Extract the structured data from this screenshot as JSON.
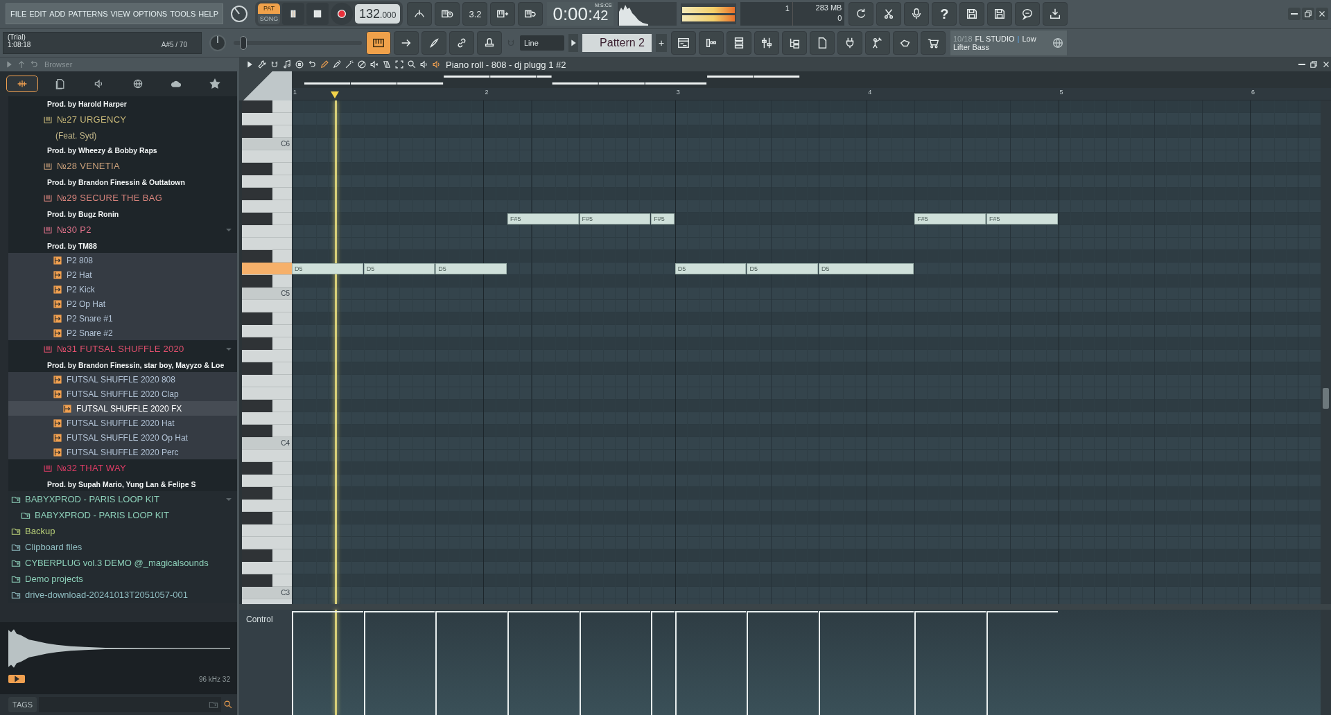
{
  "menu": [
    "FILE",
    "EDIT",
    "ADD",
    "PATTERNS",
    "VIEW",
    "OPTIONS",
    "TOOLS",
    "HELP"
  ],
  "mode": [
    {
      "label": "PAT",
      "selected": true
    },
    {
      "label": "SONG",
      "selected": false
    }
  ],
  "tempo": {
    "whole": "132",
    "fraction": ".000"
  },
  "countdown_label": "3.2",
  "time": {
    "main": "0:00:",
    "cs": "42",
    "unit": "M:S:CS"
  },
  "cpu": {
    "value": "1",
    "memory": "283 MB",
    "polyphony": "0"
  },
  "help_label": "?",
  "hint": {
    "title": "(Trial)",
    "time": "1:08:18",
    "note": "A#5 / 70"
  },
  "view_buttons": [
    {
      "selected": true
    },
    {
      "selected": false
    },
    {
      "selected": false
    },
    {
      "selected": false
    },
    {
      "selected": false
    }
  ],
  "master_slider": {
    "level": 0.05
  },
  "snap": "Line",
  "pattern": {
    "name": "Pattern 2",
    "add": "+"
  },
  "news": {
    "counter": "10/18",
    "title": "FL STUDIO",
    "separator": "|",
    "rest": "Low",
    "line2": "Lifter Bass"
  },
  "browser": {
    "title": "Browser",
    "tabs": [
      {
        "selected": true
      },
      {
        "selected": false
      },
      {
        "selected": false
      },
      {
        "selected": false
      },
      {
        "selected": false
      },
      {
        "selected": false
      }
    ],
    "items": [
      {
        "kind": "credit",
        "text": "Prod. by Harold Harper"
      },
      {
        "kind": "project",
        "text": "№27 URGENCY",
        "color": "#c8b878",
        "expanded": false
      },
      {
        "kind": "note",
        "text": "(Feat. Syd)"
      },
      {
        "kind": "credit",
        "text": "Prod. by Wheezy & Bobby Raps"
      },
      {
        "kind": "project",
        "text": "№28 VENETIA",
        "color": "#c9a07a",
        "expanded": false
      },
      {
        "kind": "credit",
        "text": "Prod. by Brandon Finessin & Outtatown"
      },
      {
        "kind": "project",
        "text": "№29 SECURE THE BAG",
        "color": "#d9847c",
        "expanded": false
      },
      {
        "kind": "credit",
        "text": "Prod. by Bugz Ronin"
      },
      {
        "kind": "project",
        "text": "№30 P2",
        "color": "#e0728a",
        "expanded": true
      },
      {
        "kind": "credit",
        "text": "Prod. by TM88"
      },
      {
        "kind": "sample",
        "text": "P2 808",
        "selected": false
      },
      {
        "kind": "sample",
        "text": "P2 Hat",
        "selected": false
      },
      {
        "kind": "sample",
        "text": "P2 Kick",
        "selected": false
      },
      {
        "kind": "sample",
        "text": "P2 Op Hat",
        "selected": false
      },
      {
        "kind": "sample",
        "text": "P2 Snare #1",
        "selected": false
      },
      {
        "kind": "sample",
        "text": "P2 Snare #2",
        "selected": false
      },
      {
        "kind": "project",
        "text": "№31 FUTSAL SHUFFLE 2020",
        "color": "#e4506e",
        "expanded": true
      },
      {
        "kind": "credit",
        "text": "Prod. by Brandon Finessin, star boy, Mayyzo & Loe"
      },
      {
        "kind": "sample",
        "text": "FUTSAL SHUFFLE 2020 808",
        "selected": false
      },
      {
        "kind": "sample",
        "text": "FUTSAL SHUFFLE 2020 Clap",
        "selected": false
      },
      {
        "kind": "sample",
        "text": "FUTSAL SHUFFLE 2020 FX",
        "selected": true
      },
      {
        "kind": "sample",
        "text": "FUTSAL SHUFFLE 2020 Hat",
        "selected": false
      },
      {
        "kind": "sample",
        "text": "FUTSAL SHUFFLE 2020 Op Hat",
        "selected": false
      },
      {
        "kind": "sample",
        "text": "FUTSAL SHUFFLE 2020 Perc",
        "selected": false
      },
      {
        "kind": "project",
        "text": "№32 THAT WAY",
        "color": "#e03c66",
        "expanded": false
      },
      {
        "kind": "credit",
        "text": "Prod. by Supah Mario, Yung Lan & Felipe S"
      },
      {
        "kind": "folder",
        "text": "BABYXPROD - PARIS LOOP KIT",
        "color": "#8ccfb8",
        "expanded": true
      },
      {
        "kind": "subfolder",
        "text": "BABYXPROD - PARIS LOOP KIT",
        "color": "#8ccfb8"
      },
      {
        "kind": "folder",
        "text": "Backup",
        "color": "#b8cf78",
        "expanded": false
      },
      {
        "kind": "folder",
        "text": "Clipboard files",
        "color": "#8fbcc0",
        "expanded": false
      },
      {
        "kind": "folder",
        "text": "CYBERPLUG vol.3 DEMO @_magicalsounds",
        "color": "#8ccfb8",
        "expanded": false
      },
      {
        "kind": "folder",
        "text": "Demo projects",
        "color": "#8ccfb8",
        "expanded": false
      },
      {
        "kind": "folder",
        "text": "drive-download-20241013T2051057-001",
        "color": "#8fbcc0",
        "expanded": false
      }
    ],
    "preview": {
      "info": "96 kHz 32"
    },
    "tags_label": "TAGS"
  },
  "piano_roll": {
    "title": "Piano roll - 808 - dj plugg 1 #2",
    "bars": [
      "1",
      "2",
      "3",
      "4",
      "5",
      "6"
    ],
    "playhead": {
      "level": 0.042
    },
    "keyboard": {
      "c_labels": [
        "C6",
        "C5",
        "C4",
        "C3"
      ]
    },
    "notes": [
      {
        "label": "D5"
      },
      {
        "label": "D5"
      },
      {
        "label": "D5"
      },
      {
        "label": "F#5"
      },
      {
        "label": "F#5"
      },
      {
        "label": "F#5"
      },
      {
        "label": "D5"
      },
      {
        "label": "D5"
      },
      {
        "label": "D5"
      },
      {
        "label": "F#5"
      },
      {
        "label": "F#5"
      }
    ],
    "control_label": "Control"
  }
}
